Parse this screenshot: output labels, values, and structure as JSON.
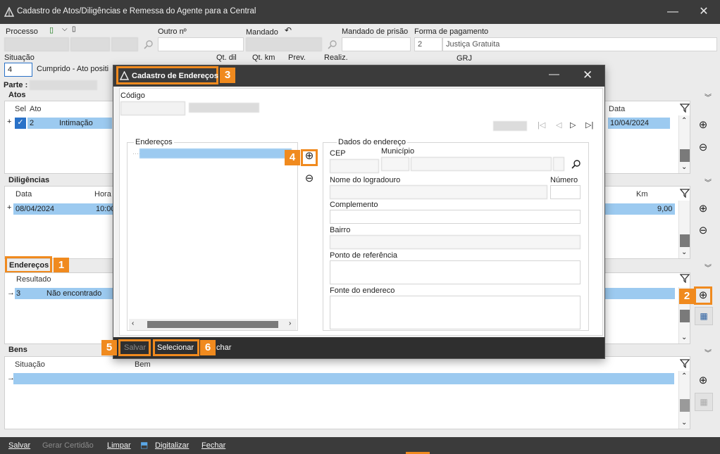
{
  "window": {
    "title": "Cadastro de Atos/Diligências e Remessa do Agente para a Central",
    "minimize": "—",
    "close": "✕"
  },
  "header": {
    "processo_label": "Processo",
    "outro_label": "Outro nº",
    "mandado_label": "Mandado",
    "mandado_prisao_label": "Mandado de prisão",
    "forma_pagamento_label": "Forma de pagamento",
    "forma_pagamento_code": "2",
    "forma_pagamento_value": "Justiça Gratuita",
    "situacao_label": "Situação",
    "situacao_code": "4",
    "situacao_value": "Cumprido - Ato positi",
    "qt_dil_label": "Qt. dil",
    "qt_km_label": "Qt. km",
    "prev_label": "Prev.",
    "realiz_label": "Realiz.",
    "grj_label": "GRJ",
    "parte_label": "Parte :"
  },
  "atos": {
    "title": "Atos",
    "columns": [
      "Sel",
      "Ato",
      "Data"
    ],
    "row": {
      "sel_number": "2",
      "ato": "Intimação",
      "data": "10/04/2024"
    }
  },
  "diligencias": {
    "title": "Diligências",
    "columns": [
      "Data",
      "Hora",
      "Km"
    ],
    "row": {
      "data": "08/04/2024",
      "hora": "10:00",
      "km": "9,00"
    }
  },
  "enderecos": {
    "title": "Endereços",
    "columns": [
      "Resultado"
    ],
    "row": {
      "code": "3",
      "resultado": "Não encontrado"
    }
  },
  "bens": {
    "title": "Bens",
    "columns": [
      "Situação",
      "Bem"
    ]
  },
  "badges": {
    "b1": "1",
    "b2": "2",
    "b3": "3",
    "b4": "4",
    "b5": "5",
    "b6": "6"
  },
  "bottom_bar": {
    "salvar": "Salvar",
    "gerar_certidao": "Gerar Certidão",
    "limpar": "Limpar",
    "digitalizar": "Digitalizar",
    "fechar": "Fechar"
  },
  "dialog": {
    "title": "Cadastro de Endereços",
    "codigo_label": "Código",
    "enderecos_group": "Endereços",
    "dados_group": "Dados do endereço",
    "cep_label": "CEP",
    "municipio_label": "Município",
    "logradouro_label": "Nome do logradouro",
    "numero_label": "Número",
    "complemento_label": "Complemento",
    "bairro_label": "Bairro",
    "referencia_label": "Ponto de referência",
    "fonte_label": "Fonte do endereco",
    "footer": {
      "salvar": "Salvar",
      "selecionar": "Selecionar",
      "fechar": "char"
    }
  },
  "icons": {
    "add": "⊕",
    "remove": "⊖",
    "filter": "filter-icon",
    "chevron": "double-chevron-icon",
    "search": "search-icon",
    "nav_first": "|◁",
    "nav_prev": "◁",
    "nav_next": "▷",
    "nav_last": "▷|"
  },
  "colors": {
    "accent": "#f08a1e",
    "selection": "#9ccaf0",
    "titlebar": "#3b3b3b"
  }
}
